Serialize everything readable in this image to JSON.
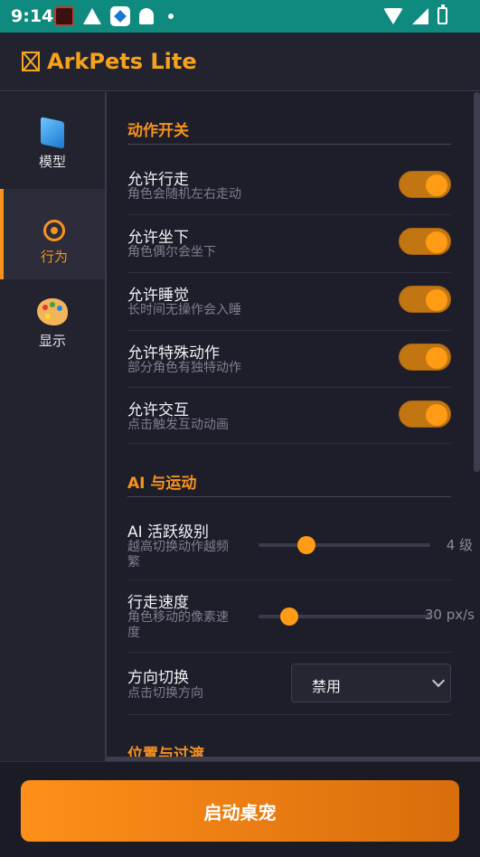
{
  "status_bar": {
    "time": "9:14"
  },
  "app": {
    "title": "ArkPets Lite"
  },
  "sidebar": {
    "items": [
      {
        "label": "模型",
        "icon": "folder-icon"
      },
      {
        "label": "行为",
        "icon": "gear-icon",
        "active": true
      },
      {
        "label": "显示",
        "icon": "palette-icon"
      }
    ]
  },
  "sections": {
    "motion": {
      "title": "动作开关",
      "toggles": [
        {
          "title": "允许行走",
          "subtitle": "角色会随机左右走动",
          "on": true
        },
        {
          "title": "允许坐下",
          "subtitle": "角色偶尔会坐下",
          "on": true
        },
        {
          "title": "允许睡觉",
          "subtitle": "长时间无操作会入睡",
          "on": true
        },
        {
          "title": "允许特殊动作",
          "subtitle": "部分角色有独特动作",
          "on": true
        },
        {
          "title": "允许交互",
          "subtitle": "点击触发互动动画",
          "on": true
        }
      ]
    },
    "ai": {
      "title": "AI 与运动",
      "activity": {
        "title": "AI 活跃级别",
        "subtitle": "越高切换动作越频繁",
        "value": "4 级",
        "fraction": 0.28
      },
      "speed": {
        "title": "行走速度",
        "subtitle": "角色移动的像素速度",
        "value": "30 px/s",
        "fraction": 0.18
      },
      "direction": {
        "title": "方向切换",
        "subtitle": "点击切换方向",
        "selected": "禁用"
      }
    },
    "position": {
      "title": "位置与过渡"
    }
  },
  "footer": {
    "start_label": "启动桌宠"
  },
  "colors": {
    "accent": "#f7931e",
    "toggle_track": "#c27612",
    "toggle_knob": "#ff9b14",
    "status_bar": "#0f8a7e"
  }
}
